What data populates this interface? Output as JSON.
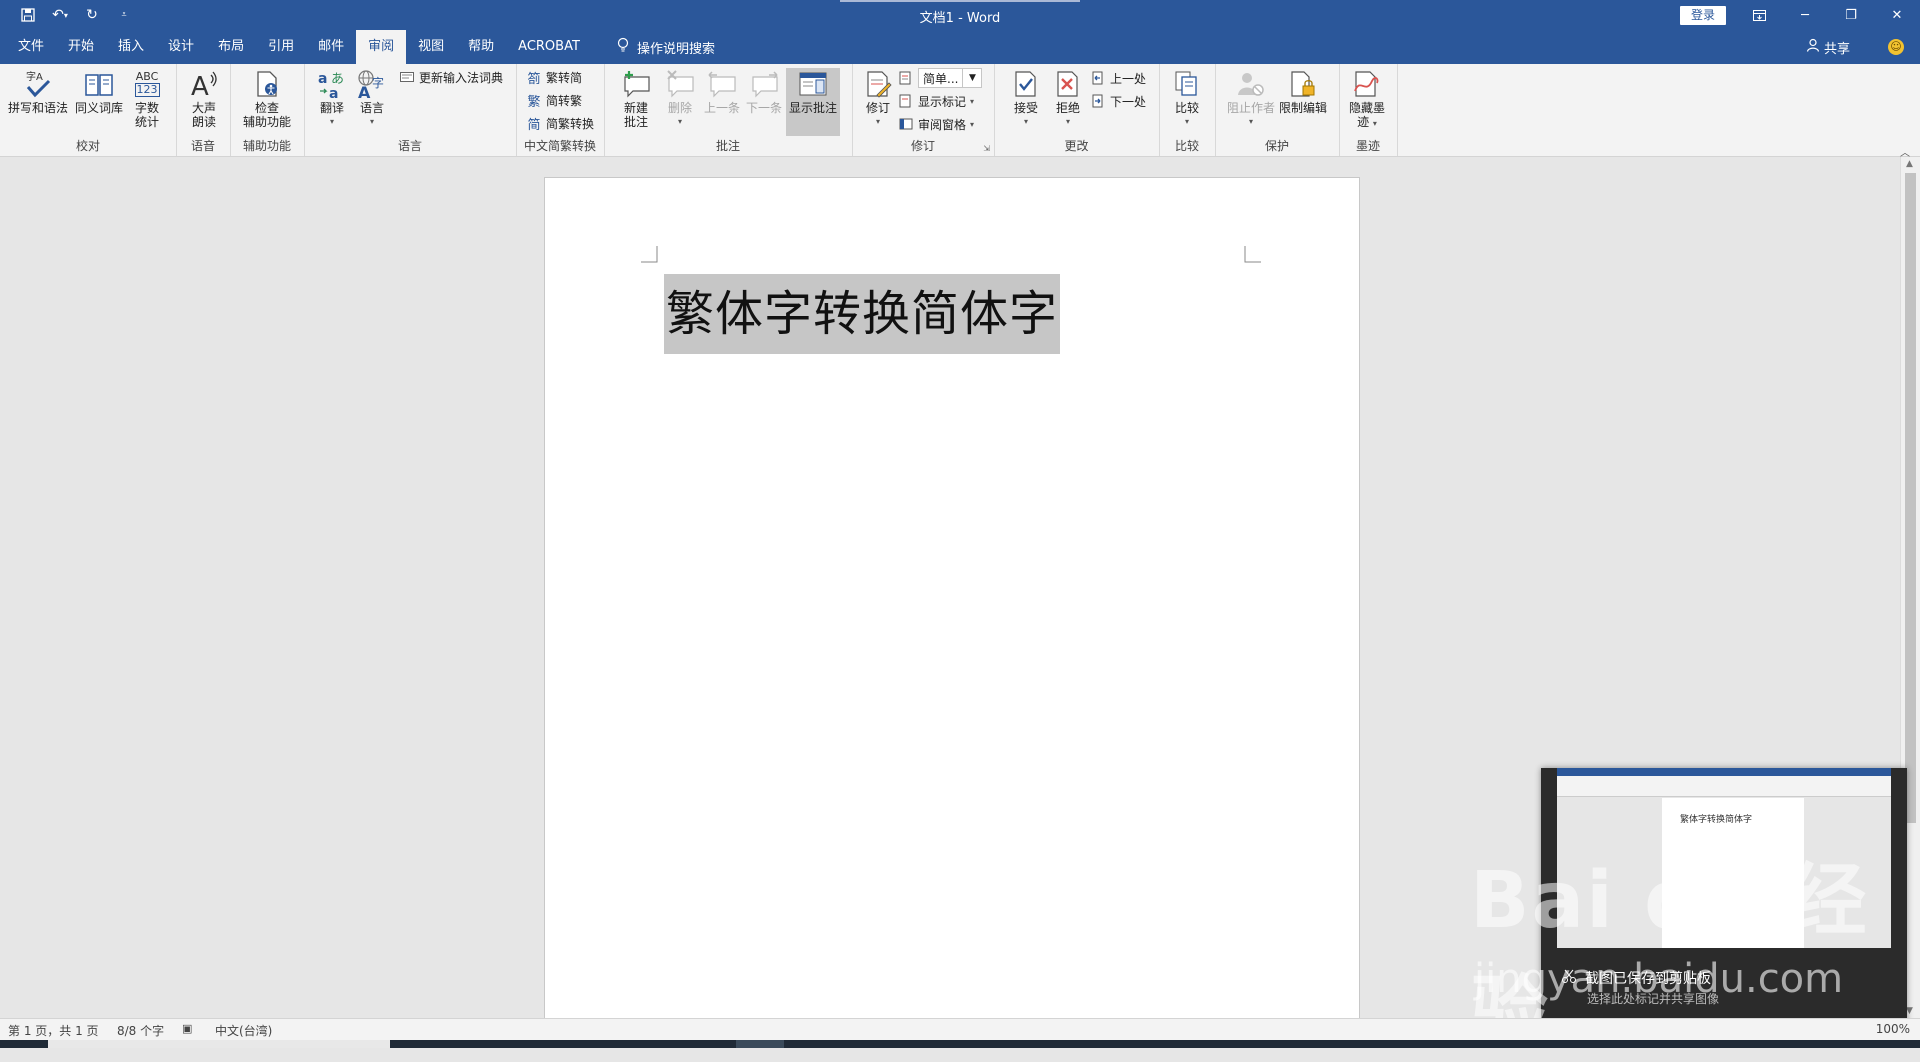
{
  "app": {
    "title": "文档1  -  Word",
    "login": "登录",
    "share": "共享"
  },
  "tabs": [
    "文件",
    "开始",
    "插入",
    "设计",
    "布局",
    "引用",
    "邮件",
    "审阅",
    "视图",
    "帮助",
    "ACROBAT"
  ],
  "active_tab": "审阅",
  "tell_me": "操作说明搜索",
  "ribbon": {
    "groups": {
      "proofing": "校对",
      "speech": "语音",
      "accessibility": "辅助功能",
      "language": "语言",
      "chinese_conversion": "中文简繁转换",
      "comments": "批注",
      "tracking": "修订",
      "changes": "更改",
      "compare": "比较",
      "protect": "保护",
      "ink": "墨迹"
    },
    "buttons": {
      "spelling": "拼写和语法",
      "thesaurus": "同义词库",
      "wordcount_1": "字数",
      "wordcount_2": "统计",
      "readaloud_1": "大声",
      "readaloud_2": "朗读",
      "check_acc_1": "检查",
      "check_acc_2": "辅助功能",
      "translate": "翻译",
      "language": "语言",
      "update_ime": "更新输入法词典",
      "trad_to_simp": "繁转简",
      "simp_to_trad": "简转繁",
      "conversion": "简繁转换",
      "new_comment_1": "新建",
      "new_comment_2": "批注",
      "delete": "删除",
      "previous": "上一条",
      "next": "下一条",
      "show_comments": "显示批注",
      "track_changes": "修订",
      "simple_markup": "简单...",
      "show_markup": "显示标记",
      "review_pane": "审阅窗格",
      "accept": "接受",
      "reject": "拒绝",
      "prev_change": "上一处",
      "next_change": "下一处",
      "compare": "比较",
      "block_authors": "阻止作者",
      "restrict_editing": "限制编辑",
      "hide_ink_1": "隐藏墨",
      "hide_ink_2": "迹"
    },
    "wordcount_icon_text_1": "ABC",
    "wordcount_icon_text_2": "123"
  },
  "document": {
    "text": "繁体字转换简体字"
  },
  "notification": {
    "title": "截图已保存到剪贴板",
    "subtitle": "选择此处标记并共享图像",
    "thumb_text": "繁体字转换简体字"
  },
  "watermark": {
    "big": "Bai du 经验",
    "small": "jingyan.baidu.com"
  },
  "status": {
    "page": "第 1 页，共 1 页",
    "words": "8/8 个字",
    "language": "中文(台湾)",
    "zoom": "100%"
  },
  "colors": {
    "accent": "#2b579a",
    "ribbon_bg": "#f3f3f3",
    "selection": "#c6c6c6"
  }
}
